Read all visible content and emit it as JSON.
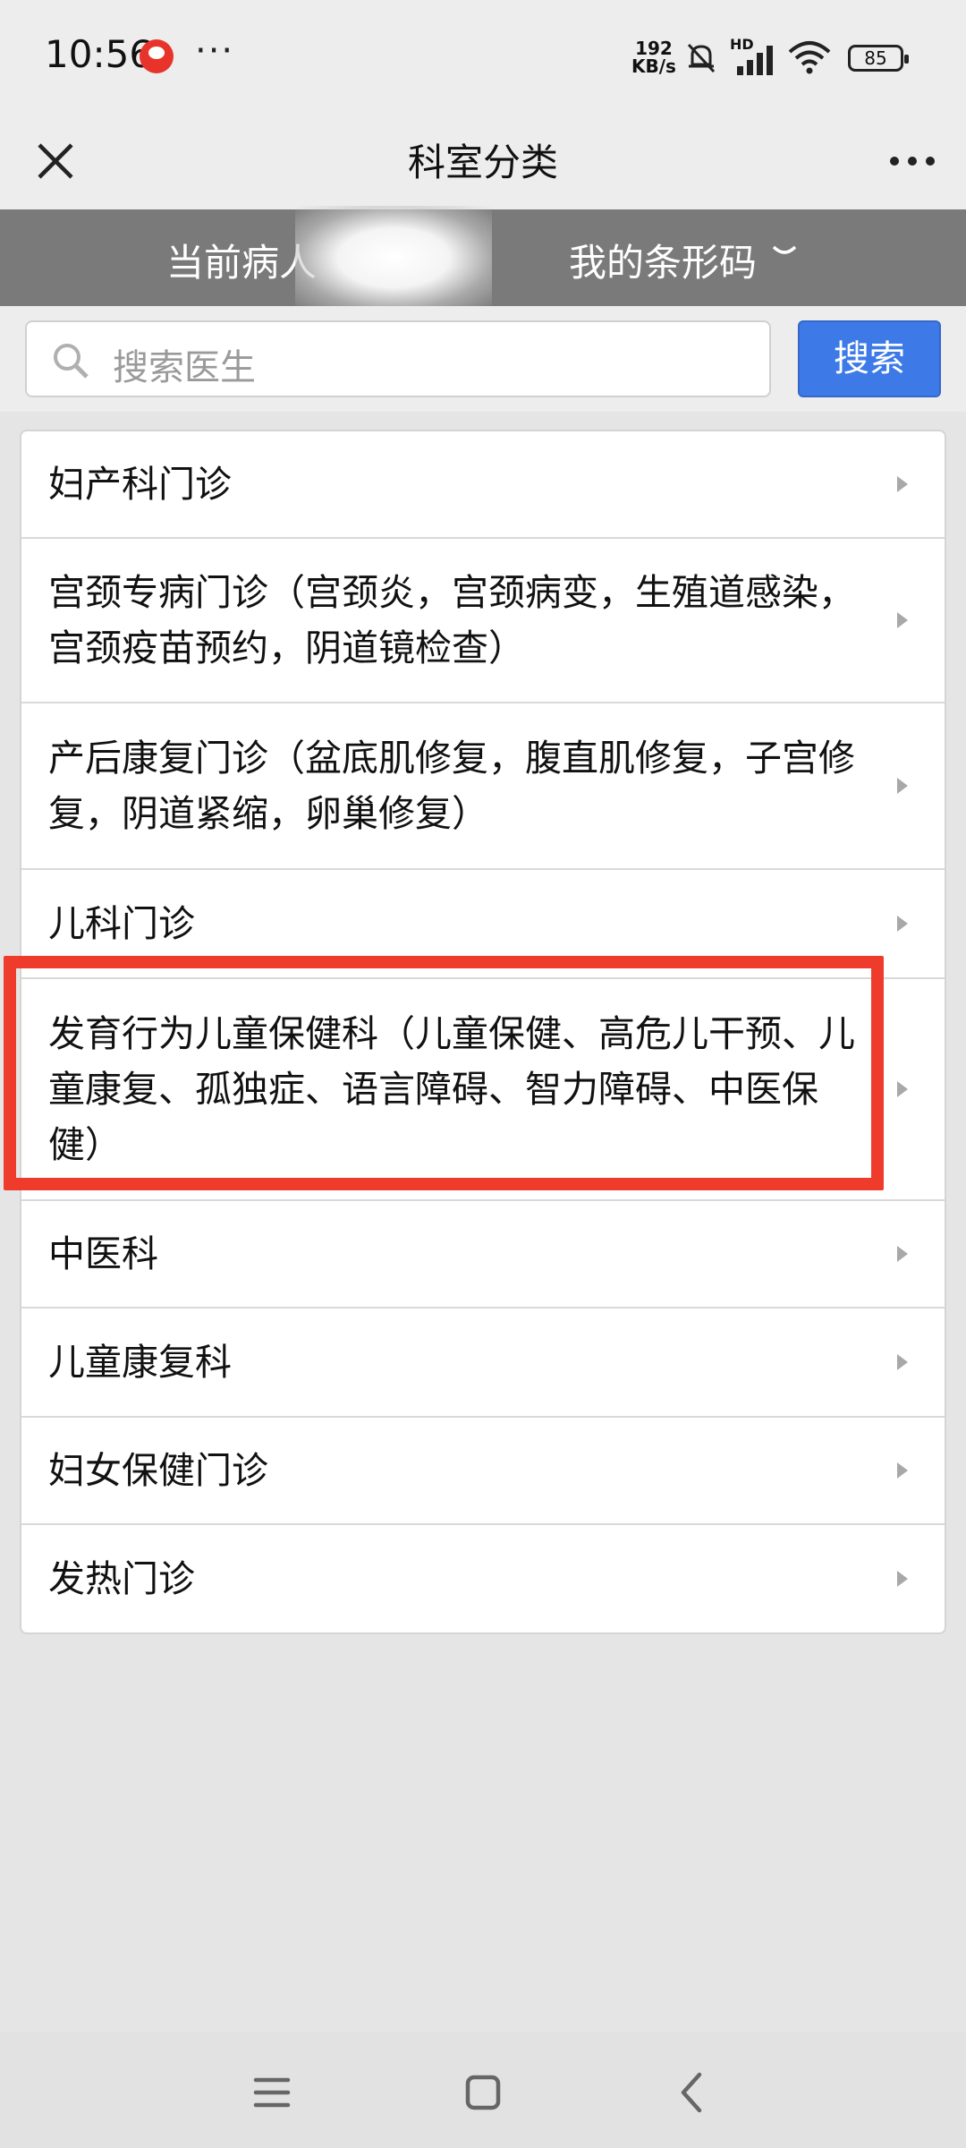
{
  "status_bar": {
    "time": "10:56",
    "more": "···",
    "network_speed_value": "192",
    "network_speed_unit": "KB/s",
    "signal_label": "HD",
    "battery": "85"
  },
  "header": {
    "title": "科室分类"
  },
  "info_bar": {
    "current_patient_label": "当前病人",
    "barcode_label": "我的条形码"
  },
  "search": {
    "placeholder": "搜索医生",
    "button_label": "搜索"
  },
  "departments": [
    {
      "label": "妇产科门诊"
    },
    {
      "label": "宫颈专病门诊（宫颈炎，宫颈病变，生殖道感染，宫颈疫苗预约，阴道镜检查）"
    },
    {
      "label": "产后康复门诊（盆底肌修复，腹直肌修复，子宫修复，阴道紧缩，卵巢修复）"
    },
    {
      "label": "儿科门诊"
    },
    {
      "label": "发育行为儿童保健科（儿童保健、高危儿干预、儿童康复、孤独症、语言障碍、智力障碍、中医保健）"
    },
    {
      "label": "中医科"
    },
    {
      "label": "儿童康复科"
    },
    {
      "label": "妇女保健门诊"
    },
    {
      "label": "发热门诊"
    }
  ],
  "colors": {
    "primary_button": "#3d7ae8",
    "info_bar": "#7a7a7a",
    "highlight_box": "#ee3b2c"
  }
}
